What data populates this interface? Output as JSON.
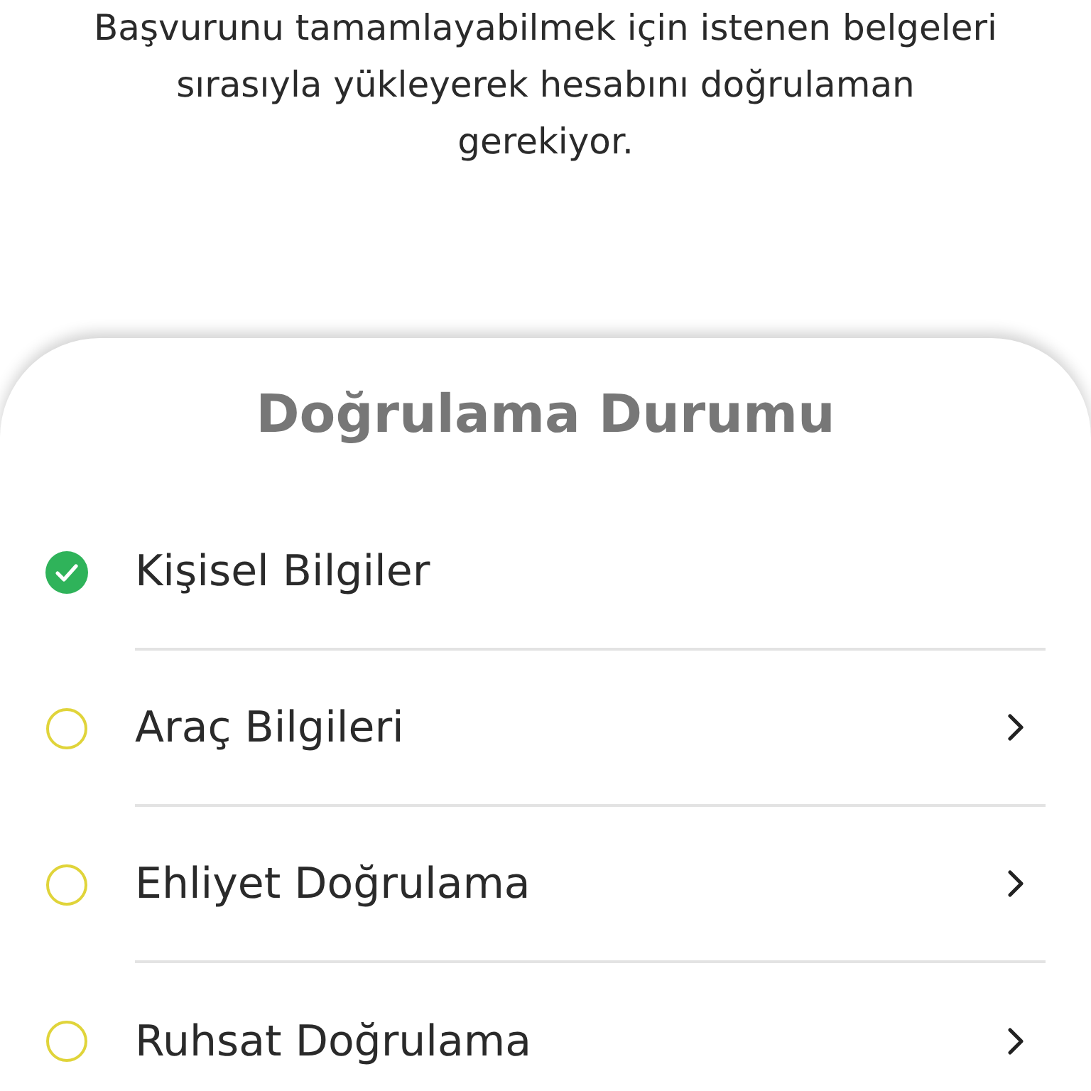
{
  "intro": "Başvurunu tamamlayabilmek için istenen belgeleri sırasıyla yükleyerek hesabını doğrulaman gerekiyor.",
  "card": {
    "title": "Doğrulama Durumu",
    "steps": [
      {
        "label": "Kişisel Bilgiler",
        "completed": true
      },
      {
        "label": "Araç Bilgileri",
        "completed": false
      },
      {
        "label": "Ehliyet Doğrulama",
        "completed": false
      },
      {
        "label": "Ruhsat Doğrulama",
        "completed": false
      }
    ]
  }
}
